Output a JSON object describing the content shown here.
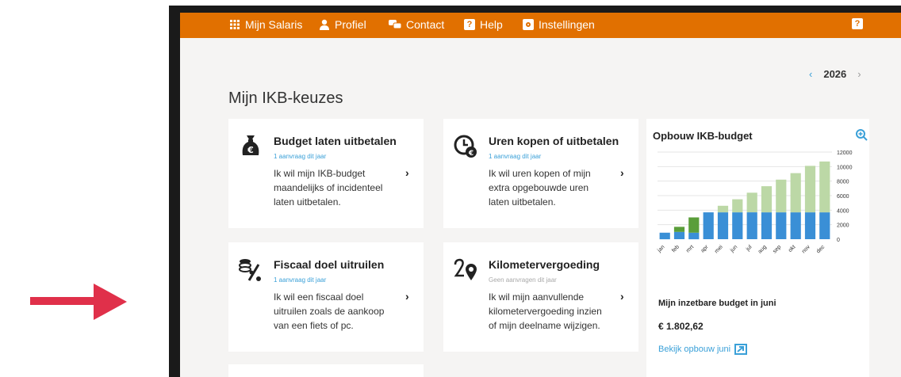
{
  "topbar": {
    "items": [
      {
        "label": "Mijn Salaris",
        "icon": "grid-icon"
      },
      {
        "label": "Profiel",
        "icon": "user-icon"
      },
      {
        "label": "Contact",
        "icon": "chat-icon"
      },
      {
        "label": "Help",
        "icon": "help-icon"
      },
      {
        "label": "Instellingen",
        "icon": "gear-icon"
      }
    ],
    "right_icon_glyph": "?"
  },
  "year": {
    "prev": "‹",
    "value": "2026",
    "next": "›"
  },
  "page_title": "Mijn IKB-keuzes",
  "cards": [
    {
      "title": "Budget laten uitbetalen",
      "sub": "1 aanvraag dit jaar",
      "body": "Ik wil mijn IKB-budget maandelijks of incidenteel laten uitbetalen.",
      "chevron": "›",
      "icon": "money-bag-icon"
    },
    {
      "title": "Uren kopen of uitbetalen",
      "sub": "1 aanvraag dit jaar",
      "body": "Ik wil uren kopen of mijn extra opgebouwde uren laten uitbetalen.",
      "chevron": "›",
      "icon": "clock-euro-icon"
    },
    {
      "title": "Fiscaal doel uitruilen",
      "sub": "1 aanvraag dit jaar",
      "body": "Ik wil een fiscaal doel uitruilen zoals de aankoop van een fiets of pc.",
      "chevron": "›",
      "icon": "coins-percent-icon"
    },
    {
      "title": "Kilometervergoeding",
      "sub": "Geen aanvragen dit jaar",
      "body": "Ik wil mijn aanvullende kilometervergoeding inzien of mijn deelname wijzigen.",
      "chevron": "›",
      "icon": "route-pin-icon"
    }
  ],
  "panel": {
    "title": "Opbouw IKB-budget",
    "budget_label": "Mijn inzetbare budget in juni",
    "budget_value": "€ 1.802,62",
    "link_label": "Bekijk opbouw juni"
  },
  "colors": {
    "orange": "#e17000",
    "blue": "#3a8fd6",
    "green_dark": "#5a9e3a",
    "green_light": "#bcd8a6",
    "link": "#3aa0d8"
  },
  "chart_data": {
    "type": "bar",
    "stacked": true,
    "categories": [
      "jan",
      "feb",
      "mrt",
      "apr",
      "mei",
      "jun",
      "jul",
      "aug",
      "sep",
      "okt",
      "nov",
      "dec"
    ],
    "series": [
      {
        "color": "blue",
        "values": [
          900,
          1000,
          900,
          3700,
          3700,
          3700,
          3700,
          3700,
          3700,
          3700,
          3700,
          3700
        ]
      },
      {
        "color": "green_dark",
        "values": [
          0,
          700,
          2100,
          0,
          0,
          0,
          0,
          0,
          0,
          0,
          0,
          0
        ]
      },
      {
        "color": "green_light",
        "values": [
          0,
          0,
          0,
          0,
          900,
          1800,
          2700,
          3600,
          4500,
          5400,
          6400,
          7000
        ]
      }
    ],
    "y_ticks": [
      "12000",
      "10000",
      "8000",
      "6000",
      "4000",
      "2000",
      "0"
    ],
    "ylim": [
      0,
      12000
    ],
    "grid": true
  }
}
